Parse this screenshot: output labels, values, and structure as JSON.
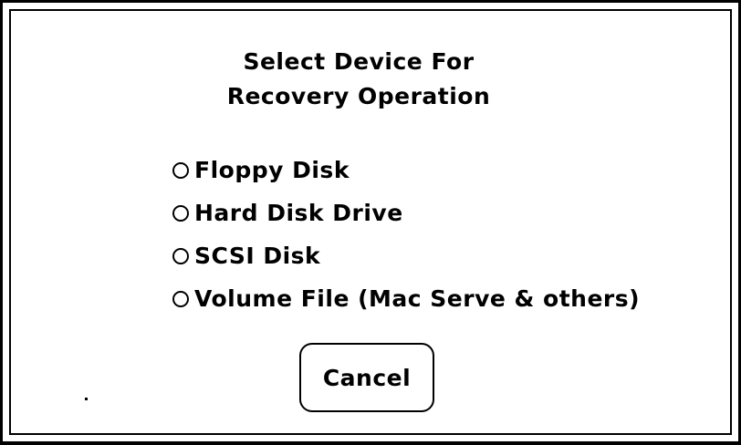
{
  "dialog": {
    "title_line1": "Select Device For",
    "title_line2": "Recovery Operation",
    "options": [
      {
        "label": "Floppy Disk",
        "selected": false
      },
      {
        "label": "Hard Disk Drive",
        "selected": false
      },
      {
        "label": "SCSI Disk",
        "selected": false
      },
      {
        "label": "Volume File (Mac Serve & others)",
        "selected": false
      }
    ],
    "cancel_label": "Cancel"
  }
}
